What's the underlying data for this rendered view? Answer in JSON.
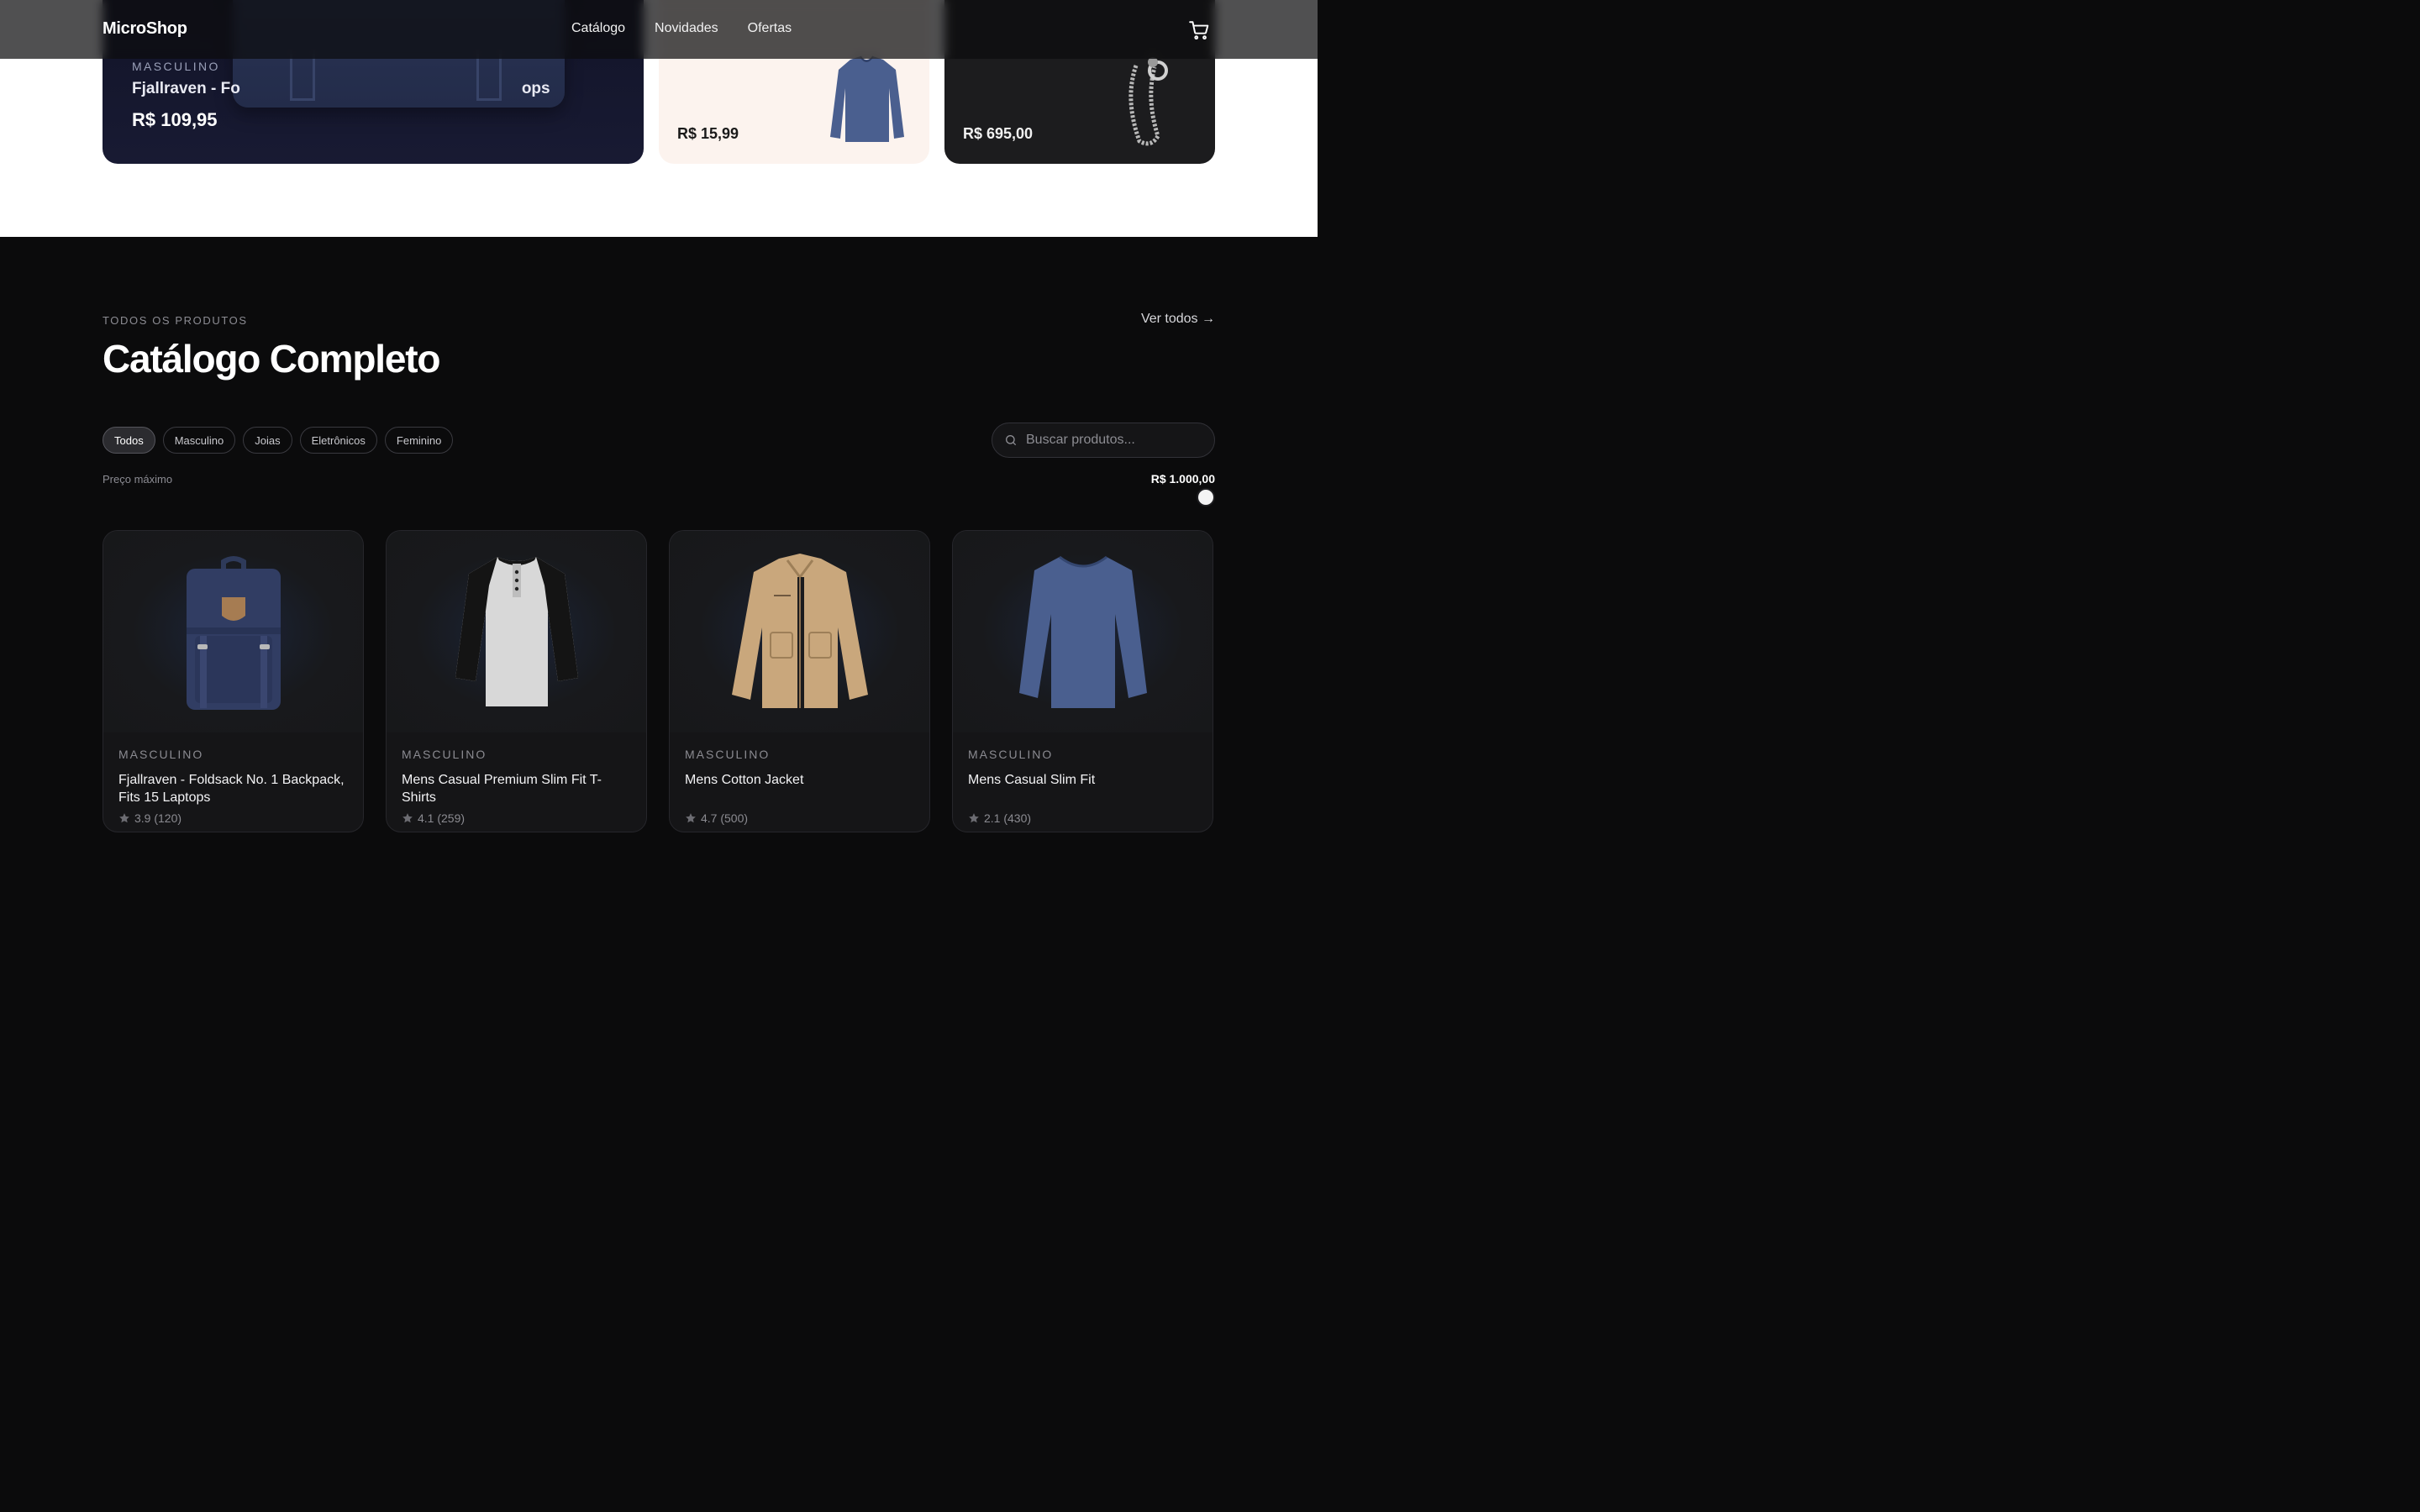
{
  "nav": {
    "logo": "MicroShop",
    "links": [
      "Catálogo",
      "Novidades",
      "Ofertas"
    ],
    "cart_icon": "cart-icon"
  },
  "featured": {
    "main": {
      "category": "MASCULINO",
      "title": "Fjallraven - Fo",
      "title_tail": "ops",
      "price": "R$ 109,95"
    },
    "shirt": {
      "price": "R$ 15,99"
    },
    "jewel": {
      "price": "R$ 695,00"
    }
  },
  "catalog": {
    "eyebrow": "TODOS OS PRODUTOS",
    "title": "Catálogo Completo",
    "see_all": "Ver todos →",
    "filters": [
      "Todos",
      "Masculino",
      "Joias",
      "Eletrônicos",
      "Feminino"
    ],
    "active_filter": "Todos",
    "search_placeholder": "Buscar produtos...",
    "price_label": "Preço máximo",
    "price_value": "R$ 1.000,00",
    "price_fraction": 1.0,
    "products": [
      {
        "category": "MASCULINO",
        "title": "Fjallraven - Foldsack No. 1 Backpack, Fits 15 Laptops",
        "rating": "3.9 (120)"
      },
      {
        "category": "MASCULINO",
        "title": "Mens Casual Premium Slim Fit T-Shirts",
        "rating": "4.1 (259)"
      },
      {
        "category": "MASCULINO",
        "title": "Mens Cotton Jacket",
        "rating": "4.7 (500)"
      },
      {
        "category": "MASCULINO",
        "title": "Mens Casual Slim Fit",
        "rating": "2.1 (430)"
      }
    ]
  },
  "colors": {
    "background": "#0b0b0c",
    "accent": "#ffffff",
    "card": "#151517"
  }
}
